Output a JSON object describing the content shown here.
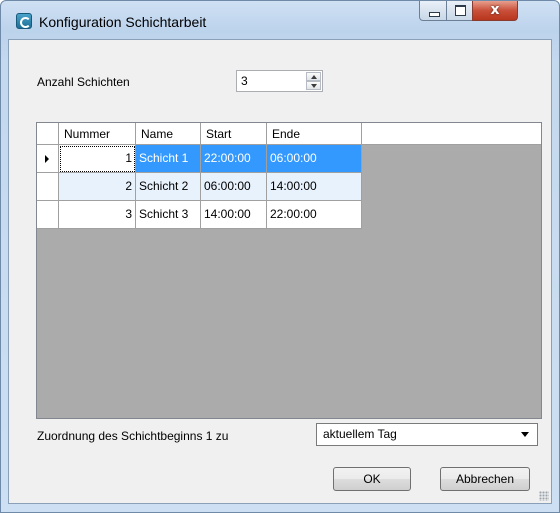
{
  "window": {
    "title": "Konfiguration Schichtarbeit",
    "close_glyph": "x",
    "icons": {
      "app": "app-logo-icon",
      "minimize": "minimize-icon",
      "maximize": "maximize-icon",
      "close": "close-icon"
    }
  },
  "shift_count": {
    "label": "Anzahl Schichten",
    "value": "3"
  },
  "grid": {
    "columns": [
      "Nummer",
      "Name",
      "Start",
      "Ende"
    ],
    "rows": [
      {
        "nummer": "1",
        "name": "Schicht 1",
        "start": "22:00:00",
        "ende": "06:00:00"
      },
      {
        "nummer": "2",
        "name": "Schicht 2",
        "start": "06:00:00",
        "ende": "14:00:00"
      },
      {
        "nummer": "3",
        "name": "Schicht 3",
        "start": "14:00:00",
        "ende": "22:00:00"
      }
    ],
    "selected_row": 0
  },
  "assignment": {
    "label": "Zuordnung des Schichtbeginns 1 zu",
    "selected": "aktuellem Tag"
  },
  "buttons": {
    "ok": "OK",
    "cancel": "Abbrechen"
  },
  "colors": {
    "selection": "#3399ff",
    "alt_row": "#e8f2fd",
    "grid_bg": "#ababab"
  }
}
